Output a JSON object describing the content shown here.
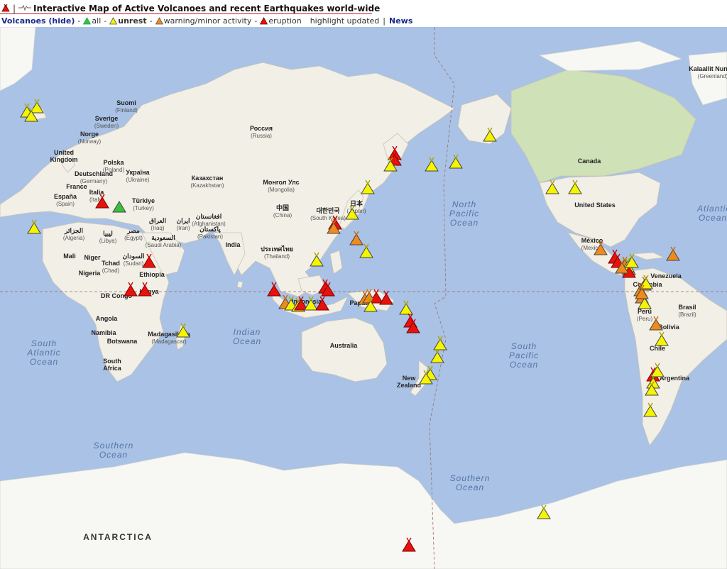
{
  "header": {
    "title": "Interactive Map of Active Volcanoes and recent Earthquakes world-wide",
    "separator": "|",
    "volcanoes_link": "Volcanoes (hide)",
    "legend": {
      "all": "all",
      "unrest": "unrest",
      "warning": "warning/minor activity",
      "eruption": "eruption"
    },
    "highlight": "highlight updated",
    "news": "News"
  },
  "colors": {
    "ocean": "#a9c2e5",
    "land": "#f2efe7",
    "all": "#3cbf3c",
    "unrest": "#f5f500",
    "warning": "#f08a1c",
    "eruption": "#e8120c"
  },
  "map": {
    "countries": [
      {
        "name": "Suomi",
        "sub": "(Finland)"
      },
      {
        "name": "Sverige",
        "sub": "(Sweden)"
      },
      {
        "name": "Norge",
        "sub": "(Norway)"
      },
      {
        "name": "United",
        "sub": "Kingdom"
      },
      {
        "name": "Polska",
        "sub": "(Poland)"
      },
      {
        "name": "Deutschland",
        "sub": "(Germany)"
      },
      {
        "name": "France",
        "sub": ""
      },
      {
        "name": "España",
        "sub": "(Spain)"
      },
      {
        "name": "Italia",
        "sub": "(Italy)"
      },
      {
        "name": "Україна",
        "sub": "(Ukraine)"
      },
      {
        "name": "Türkiye",
        "sub": "(Turkey)"
      },
      {
        "name": "Россия",
        "sub": "(Russia)"
      },
      {
        "name": "Казахстан",
        "sub": "(Kazakhstan)"
      },
      {
        "name": "Монгол Улс",
        "sub": "(Mongolia)"
      },
      {
        "name": "中国",
        "sub": "(China)"
      },
      {
        "name": "日本",
        "sub": "(Japan)"
      },
      {
        "name": "대한민국",
        "sub": "(South Korea)"
      },
      {
        "name": "الجزائر",
        "sub": "(Algeria)"
      },
      {
        "name": "ليبيا",
        "sub": "(Libya)"
      },
      {
        "name": "مصر",
        "sub": "(Egypt)"
      },
      {
        "name": "العراق",
        "sub": "(Iraq)"
      },
      {
        "name": "ایران",
        "sub": "(Iran)"
      },
      {
        "name": "افغانستان",
        "sub": "(Afghanistan)"
      },
      {
        "name": "پاکستان",
        "sub": "(Pakistan)"
      },
      {
        "name": "السعودية",
        "sub": "(Saudi Arabia)"
      },
      {
        "name": "India",
        "sub": ""
      },
      {
        "name": "ประเทศไทย",
        "sub": "(Thailand)"
      },
      {
        "name": "Mali",
        "sub": ""
      },
      {
        "name": "Niger",
        "sub": ""
      },
      {
        "name": "Nigeria",
        "sub": ""
      },
      {
        "name": "Tchad",
        "sub": "(Chad)"
      },
      {
        "name": "السودان",
        "sub": "(Sudan)"
      },
      {
        "name": "Ethiopia",
        "sub": ""
      },
      {
        "name": "DR Congo",
        "sub": ""
      },
      {
        "name": "Kenya",
        "sub": ""
      },
      {
        "name": "Angola",
        "sub": ""
      },
      {
        "name": "Namibia",
        "sub": ""
      },
      {
        "name": "Botswana",
        "sub": ""
      },
      {
        "name": "South",
        "sub": "Africa"
      },
      {
        "name": "Madagasikara",
        "sub": "(Madagascar)"
      },
      {
        "name": "Indonesia",
        "sub": ""
      },
      {
        "name": "Papua",
        "sub": ""
      },
      {
        "name": "Australia",
        "sub": ""
      },
      {
        "name": "New",
        "sub": "Zealand"
      },
      {
        "name": "Canada",
        "sub": ""
      },
      {
        "name": "United States",
        "sub": ""
      },
      {
        "name": "México",
        "sub": "(Mexico)"
      },
      {
        "name": "Venezuela",
        "sub": ""
      },
      {
        "name": "Colombia",
        "sub": ""
      },
      {
        "name": "Perú",
        "sub": "(Peru)"
      },
      {
        "name": "Brasil",
        "sub": "(Brazil)"
      },
      {
        "name": "Bolivia",
        "sub": ""
      },
      {
        "name": "Chile",
        "sub": ""
      },
      {
        "name": "Argentina",
        "sub": ""
      },
      {
        "name": "Kalaallit Nunaat",
        "sub": "(Greenland)"
      }
    ],
    "oceans": [
      "North Pacific Ocean",
      "Atlantic Ocean",
      "Indian Ocean",
      "South Atlantic Ocean",
      "South Pacific Ocean",
      "Southern Ocean",
      "Southern Ocean"
    ],
    "antarctica": "ANTARCTICA",
    "volcano_counts": {
      "unrest": 40,
      "warning": 22,
      "eruption": 27,
      "all": 1
    }
  }
}
